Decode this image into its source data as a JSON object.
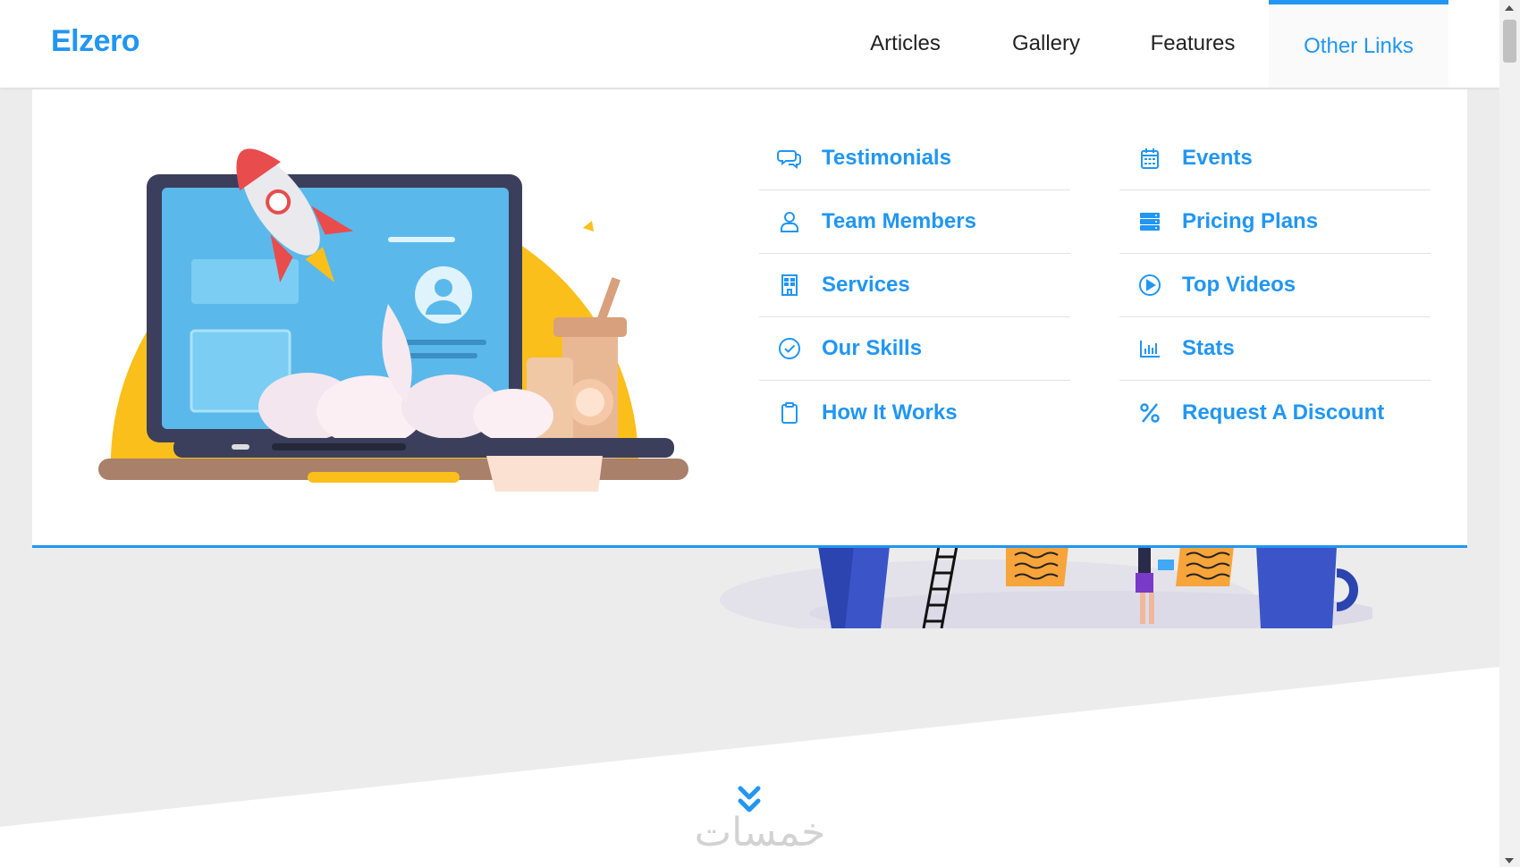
{
  "header": {
    "logo": "Elzero",
    "nav": [
      {
        "label": "Articles"
      },
      {
        "label": "Gallery"
      },
      {
        "label": "Features"
      },
      {
        "label": "Other Links"
      }
    ]
  },
  "mega_menu": {
    "left_column": [
      {
        "label": "Testimonials",
        "icon": "comments-icon"
      },
      {
        "label": "Team Members",
        "icon": "user-icon"
      },
      {
        "label": "Services",
        "icon": "building-icon"
      },
      {
        "label": "Our Skills",
        "icon": "check-circle-icon"
      },
      {
        "label": "How It Works",
        "icon": "clipboard-icon"
      }
    ],
    "right_column": [
      {
        "label": "Events",
        "icon": "calendar-icon"
      },
      {
        "label": "Pricing Plans",
        "icon": "server-icon"
      },
      {
        "label": "Top Videos",
        "icon": "play-circle-icon"
      },
      {
        "label": "Stats",
        "icon": "chart-bar-icon"
      },
      {
        "label": "Request A Discount",
        "icon": "percent-icon"
      }
    ]
  },
  "watermark": "خمسات",
  "colors": {
    "accent": "#2196f3",
    "page_bg": "#ececec",
    "text": "#222222"
  }
}
